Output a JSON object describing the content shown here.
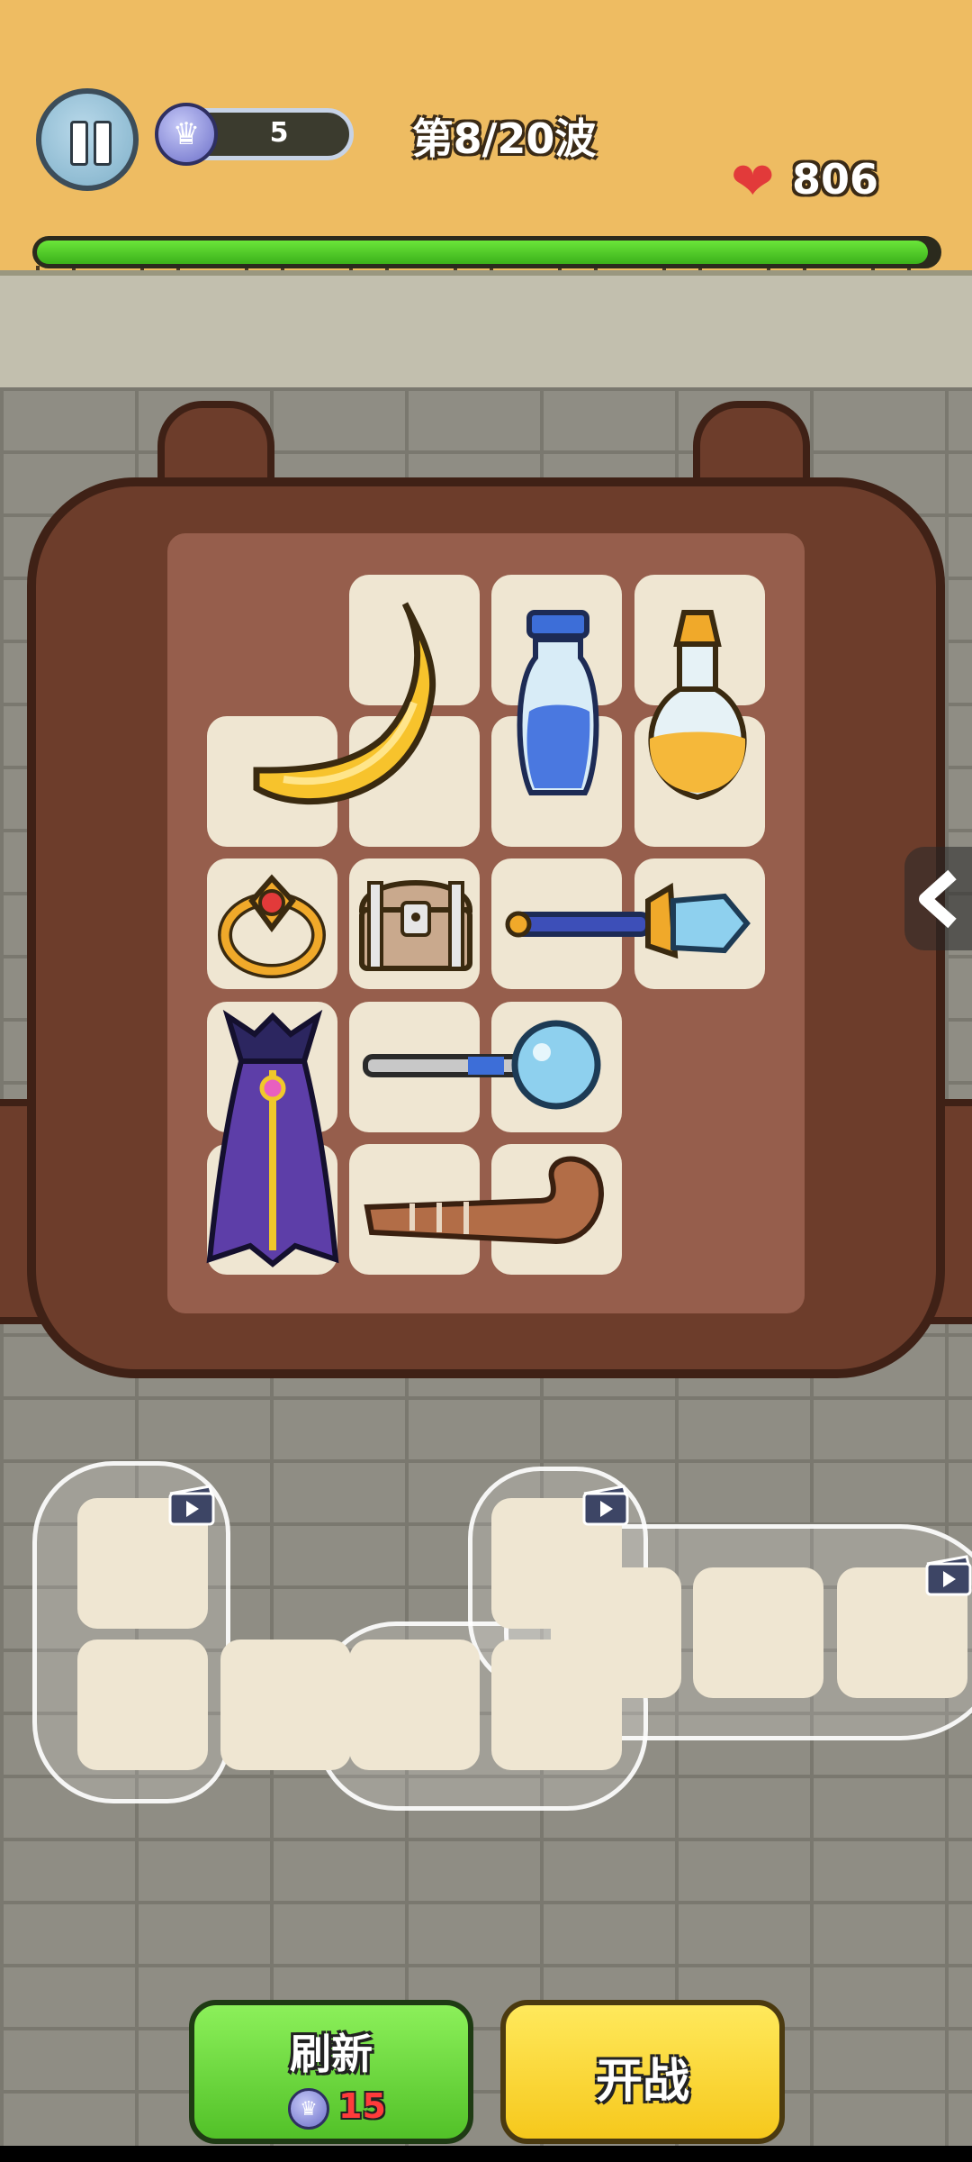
{
  "hud": {
    "pause_icon": "pause-icon",
    "crown_icon": "crown-icon",
    "crown_count": "5",
    "wave_label": "第8/20波",
    "heart_icon": "heart-icon",
    "hp_value": "806",
    "hp_bar_fraction": 0.99
  },
  "backpack": {
    "items": [
      {
        "name": "banana",
        "icon": "banana-icon"
      },
      {
        "name": "blue-potion",
        "icon": "blue-potion-icon"
      },
      {
        "name": "yellow-potion",
        "icon": "yellow-potion-icon"
      },
      {
        "name": "gold-ring",
        "icon": "ring-icon"
      },
      {
        "name": "treasure-chest",
        "icon": "chest-icon"
      },
      {
        "name": "crystal-wand",
        "icon": "crystal-wand-icon"
      },
      {
        "name": "purple-cloak",
        "icon": "cloak-icon"
      },
      {
        "name": "orb-staff",
        "icon": "orb-staff-icon"
      },
      {
        "name": "wooden-crook",
        "icon": "crook-icon"
      }
    ],
    "side_arrow_icon": "chevron-left-icon"
  },
  "shop": {
    "video_icon": "video-ad-icon"
  },
  "buttons": {
    "refresh_label": "刷新",
    "refresh_cost": "15",
    "fight_label": "开战"
  },
  "colors": {
    "sky": "#eebc62",
    "hp_bar": "#4fcf24",
    "refresh_button": "#6bd83c",
    "fight_button": "#fbd634",
    "backpack": "#6d3d2b"
  }
}
